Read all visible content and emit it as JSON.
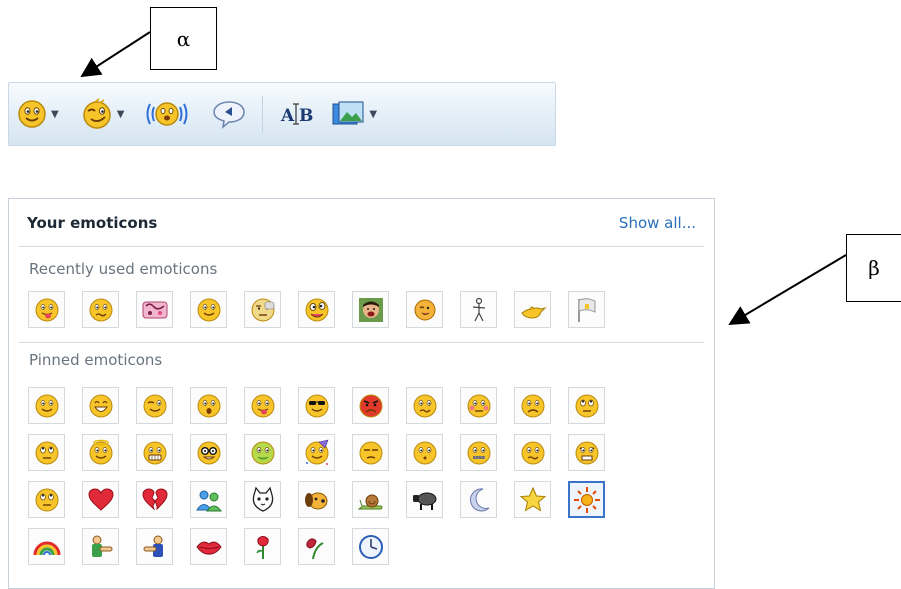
{
  "callouts": {
    "alpha": "α",
    "beta": "β"
  },
  "toolbar": {
    "buttons": [
      {
        "name": "emoticon-button",
        "icon": "smiley-icon",
        "dropdown": true
      },
      {
        "name": "winks-button",
        "icon": "wink-icon",
        "dropdown": true
      },
      {
        "name": "nudge-button",
        "icon": "nudge-icon",
        "dropdown": false
      },
      {
        "name": "voice-clip-button",
        "icon": "speech-bubble-icon",
        "dropdown": false
      },
      {
        "name": "font-button",
        "icon": "font-icon",
        "dropdown": false,
        "text": "AB"
      },
      {
        "name": "background-button",
        "icon": "picture-icon",
        "dropdown": true
      }
    ]
  },
  "panel": {
    "title": "Your emoticons",
    "show_all": "Show all...",
    "recent_label": "Recently used emoticons",
    "pinned_label": "Pinned emoticons",
    "recent": [
      "tongue-out",
      "confused",
      "party-animal",
      "smile",
      "thinking",
      "crazy-face",
      "photo-face",
      "wink-ball",
      "stick-figure",
      "genie-lamp",
      "flag"
    ],
    "pinned": [
      "smile",
      "open-mouth-smile",
      "wink",
      "surprised",
      "tongue-out",
      "cool-sunglasses",
      "angry",
      "confused",
      "embarrassed",
      "sad",
      "eye-roll",
      "eye-roll",
      "angel",
      "grimace",
      "nerd",
      "sick",
      "party",
      "sarcastic",
      "secret",
      "zipped-lips",
      "confused-2",
      "baring-teeth",
      "eye-roll",
      "red-heart",
      "broken-heart",
      "buddies",
      "cat",
      "dog",
      "snail",
      "sheep",
      "moon",
      "star",
      "sun",
      "rainbow",
      "boy-hug",
      "girl-hug",
      "red-lips",
      "red-rose",
      "wilted-rose",
      "clock"
    ],
    "selected_pinned_index": 32
  },
  "colors": {
    "link": "#2a6fb8",
    "selection": "#3a73c9",
    "toolbar_border": "#c9d8e6"
  }
}
